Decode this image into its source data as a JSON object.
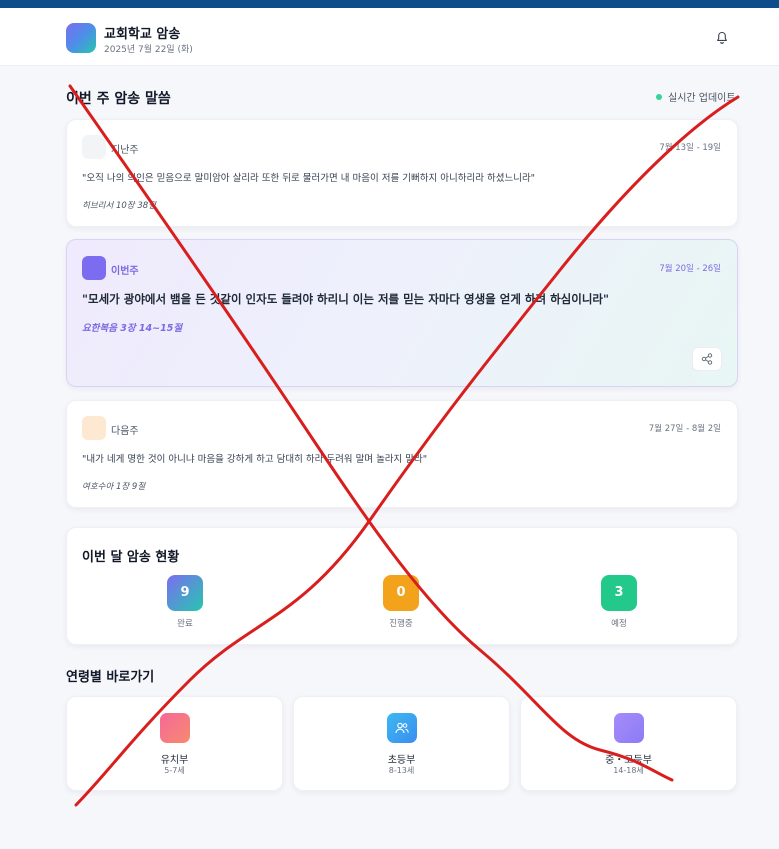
{
  "header": {
    "app_title": "교회학교 암송",
    "date": "2025년 7월 22일 (화)",
    "bell_icon": "bell-icon"
  },
  "weekly": {
    "title": "이번 주 암송 말씀",
    "live_label": "실시간 업데이트",
    "live_color": "#34d399",
    "cards": [
      {
        "label": "지난주",
        "range": "7월 13일 - 19일",
        "verse": "\"오직 나의 의인은 믿음으로 말미암아 살리라 또한 뒤로 물러가면 내 마음이 저를 기뻐하지 아니하리라 하셨느니라\"",
        "ref": "히브리서 10장 38절",
        "icon_color": "#f3f4f6"
      },
      {
        "label": "이번주",
        "range": "7월 20일 - 26일",
        "verse": "\"모세가 광야에서 뱀을 든 것같이 인자도 들려야 하리니 이는 저를 믿는 자마다 영생을 얻게 하려 하심이니라\"",
        "ref": "요한복음 3장 14~15절",
        "icon_color": "#7c6cf0",
        "share_icon": "share-icon"
      },
      {
        "label": "다음주",
        "range": "7월 27일 - 8월 2일",
        "verse": "\"내가 네게 명한 것이 아니냐 마음을 강하게 하고 담대히 하라 두려워 말며 놀라지 말라\"",
        "ref": "여호수아 1장 9절",
        "icon_color": "#fde9d2"
      }
    ]
  },
  "monthly": {
    "title": "이번 달 암송 현황",
    "stats": [
      {
        "value": "9",
        "label": "완료",
        "color": "#5b84e0"
      },
      {
        "value": "0",
        "label": "진행중",
        "color": "#f2a31b"
      },
      {
        "value": "3",
        "label": "예정",
        "color": "#22c98a"
      }
    ]
  },
  "age_groups": {
    "title": "연령별 바로가기",
    "items": [
      {
        "name": "유치부",
        "range": "5-7세",
        "color": "#f4718f",
        "icon": "kids-icon"
      },
      {
        "name": "초등부",
        "range": "8-13세",
        "color": "#3bb8f0",
        "icon": "users-icon"
      },
      {
        "name": "중・고등부",
        "range": "14-18세",
        "color": "#a78bfa",
        "icon": "teens-icon"
      }
    ]
  },
  "overlay": {
    "mark": "red-x-mark",
    "color": "#d91e1e"
  }
}
